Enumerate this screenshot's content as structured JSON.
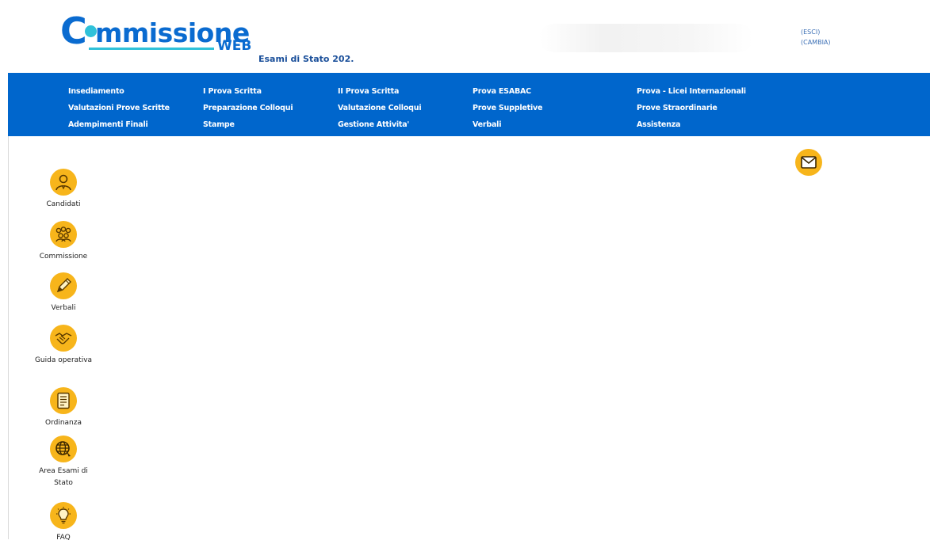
{
  "header": {
    "logo_c": "C",
    "logo_rest": "mmissione",
    "logo_web": "WEB",
    "subtitle": "Esami di Stato 202.",
    "user_links": [
      "(ESCI)",
      "(CAMBIA)"
    ]
  },
  "nav": {
    "columns": [
      [
        "Insediamento",
        "Valutazioni Prove Scritte",
        "Adempimenti Finali"
      ],
      [
        "I Prova Scritta",
        "Preparazione Colloqui",
        "Stampe"
      ],
      [
        "II Prova Scritta",
        "Valutazione Colloqui",
        "Gestione Attivita'"
      ],
      [
        "Prova ESABAC",
        "Prove Suppletive",
        "Verbali"
      ],
      [
        "Prova - Licei Internazionali",
        "Prove Straordinarie",
        "Assistenza"
      ]
    ]
  },
  "sidebar": {
    "items": [
      {
        "label": "Candidati",
        "icon": "person-icon"
      },
      {
        "label": "Commissione",
        "icon": "group-icon"
      },
      {
        "label": "Verbali",
        "icon": "pencil-icon"
      },
      {
        "label": "Guida operativa",
        "icon": "handshake-icon"
      },
      {
        "label": "Ordinanza",
        "icon": "document-icon"
      },
      {
        "label": "Area Esami di Stato",
        "icon": "globe-icon"
      },
      {
        "label": "FAQ",
        "icon": "lightbulb-icon"
      }
    ]
  },
  "mail": {
    "icon": "mail-icon"
  },
  "colors": {
    "nav_bg": "#0066cc",
    "accent": "#f7b51b",
    "logo": "#0a6bd0"
  }
}
